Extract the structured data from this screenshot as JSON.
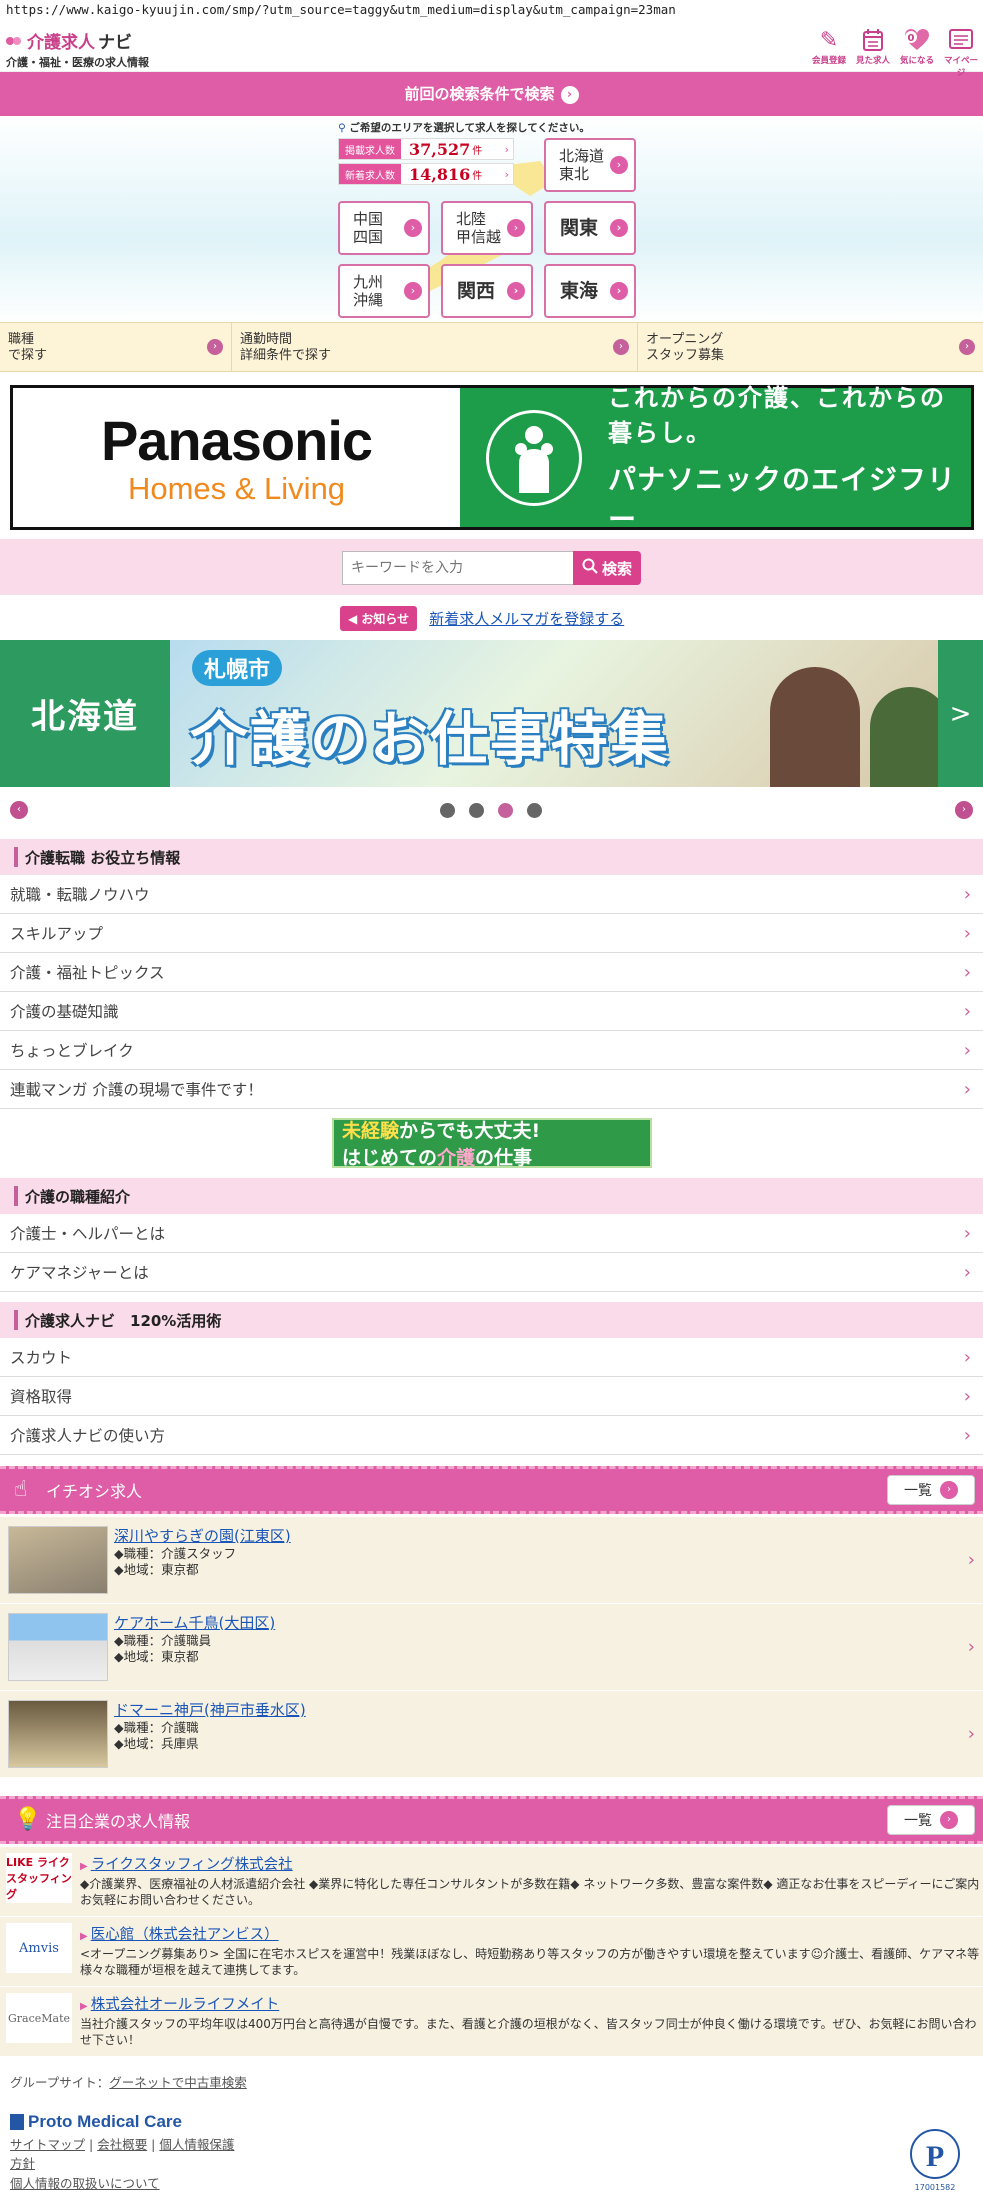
{
  "browser": {
    "url": "https://www.kaigo-kyuujin.com/smp/?utm_source=taggy&utm_medium=display&utm_campaign=23man"
  },
  "header": {
    "logo_main": "介護求人",
    "logo_kana": "ナビ",
    "logo_sub": "介護・福祉・医療の求人情報",
    "icons": [
      {
        "label": "会員登録",
        "icon": "pencil-icon"
      },
      {
        "label": "見た求人",
        "icon": "calendar-icon"
      },
      {
        "label": "気になる",
        "icon": "heart-icon",
        "badge": "0"
      },
      {
        "label": "マイページ",
        "icon": "mypage-icon"
      }
    ]
  },
  "search_again": {
    "label": "前回の検索条件で検索"
  },
  "area": {
    "hint": "ご希望のエリアを選択して求人を探してください。",
    "total": {
      "label": "掲載求人数",
      "value": "37,527",
      "unit": "件"
    },
    "new": {
      "label": "新着求人数",
      "value": "14,816",
      "unit": "件"
    },
    "regions": [
      {
        "l1": "北海道",
        "l2": "東北"
      },
      {
        "l1": "中国",
        "l2": "四国"
      },
      {
        "l1": "北陸",
        "l2": "甲信越"
      },
      {
        "l1": "関東",
        "l2": ""
      },
      {
        "l1": "九州",
        "l2": "沖縄"
      },
      {
        "l1": "関西",
        "l2": ""
      },
      {
        "l1": "東海",
        "l2": ""
      }
    ]
  },
  "quick_links": [
    {
      "l1": "職種",
      "l2": "で探す"
    },
    {
      "l1": "通勤時間",
      "l2": "詳細条件で探す"
    },
    {
      "l1": "オープニング",
      "l2": "スタッフ募集"
    }
  ],
  "ad": {
    "brand": "Panasonic",
    "sub": "Homes & Living",
    "tag1": "これからの介護、これからの暮らし。",
    "tag2": "パナソニックのエイジフリー"
  },
  "keyword": {
    "placeholder": "キーワードを入力",
    "button": "検索"
  },
  "notice": {
    "badge": "お知らせ",
    "link": "新着求人メルマガを登録する"
  },
  "slider": {
    "left_label": "北海道",
    "city": "札幌市",
    "title": "介護のお仕事特集",
    "next": ">"
  },
  "sections": {
    "tips": {
      "title": "介護転職 お役立ち情報",
      "items": [
        "就職・転職ノウハウ",
        "スキルアップ",
        "介護・福祉トピックス",
        "介護の基礎知識",
        "ちょっとブレイク",
        "連載マンガ 介護の現場で事件です！"
      ]
    },
    "promo": {
      "l1_a": "未経験",
      "l1_b": "からでも大丈夫!",
      "l2_a": "はじめての",
      "l2_b": "介護",
      "l2_c": "の仕事"
    },
    "jobs_intro": {
      "title": "介護の職種紹介",
      "items": [
        "介護士・ヘルパーとは",
        "ケアマネジャーとは"
      ]
    },
    "usage": {
      "title": "介護求人ナビ　120%活用術",
      "items": [
        "スカウト",
        "資格取得",
        "介護求人ナビの使い方"
      ]
    }
  },
  "featured": {
    "title": "イチオシ求人",
    "list_button": "一覧",
    "jobs": [
      {
        "name": "深川やすらぎの園(江東区)",
        "type": "◆職種：介護スタッフ",
        "area": "◆地域：東京都"
      },
      {
        "name": "ケアホーム千鳥(大田区)",
        "type": "◆職種：介護職員",
        "area": "◆地域：東京都"
      },
      {
        "name": "ドマーニ神戸(神戸市垂水区)",
        "type": "◆職種：介護職",
        "area": "◆地域：兵庫県"
      }
    ]
  },
  "companies": {
    "title": "注目企業の求人情報",
    "list_button": "一覧",
    "items": [
      {
        "logo": "LIKE ライクスタッフィング",
        "name": "ライクスタッフィング株式会社",
        "desc": "◆介護業界、医療福祉の人材派遣紹介会社 ◆業界に特化した専任コンサルタントが多数在籍◆ ネットワーク多数、豊富な案件数◆ 適正なお仕事をスピーディーにご案内　お気軽にお問い合わせください。"
      },
      {
        "logo": "Amvis",
        "name": "医心館（株式会社アンビス）",
        "desc": "<オープニング募集あり> 全国に在宅ホスピスを運営中！残業ほぼなし、時短勤務あり等スタッフの方が働きやすい環境を整えています☺介護士、看護師、ケアマネ等様々な職種が垣根を越えて連携してます。"
      },
      {
        "logo": "GraceMate",
        "name": "株式会社オールライフメイト",
        "desc": "当社介護スタッフの平均年収は400万円台と高待遇が自慢です。また、看護と介護の垣根がなく、皆スタッフ同士が仲良く働ける環境です。ぜひ、お気軽にお問い合わせ下さい！"
      }
    ]
  },
  "footer": {
    "group_label": "グループサイト：",
    "group_link": "グーネットで中古車検索",
    "brand": "Proto Medical Care",
    "links_row1": [
      "サイトマップ",
      "会社概要",
      "個人情報保護"
    ],
    "links_row2": "方針",
    "links_row3": "個人情報の取扱いについて",
    "privacy_number": "17001582"
  },
  "colors": {
    "accent": "#de5da6",
    "link": "#1a55b8",
    "green": "#2d9a60"
  }
}
